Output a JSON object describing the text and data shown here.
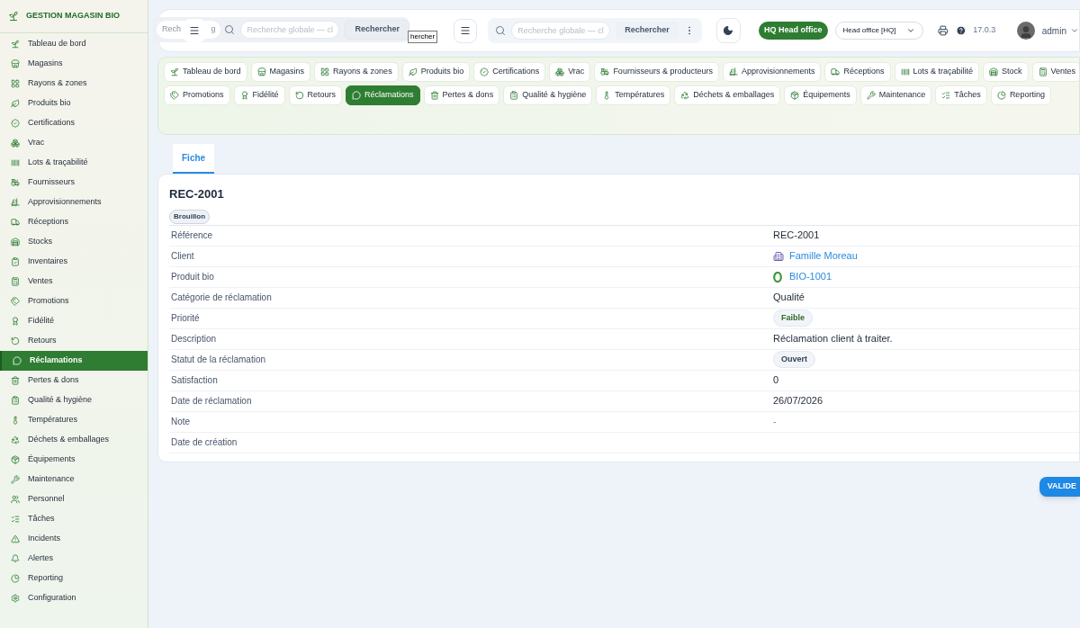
{
  "sidebar": {
    "brand": "GESTION MAGASIN BIO",
    "items": [
      {
        "label": "Tableau de bord",
        "selected": false
      },
      {
        "label": "Magasins",
        "selected": false
      },
      {
        "label": "Rayons & zones",
        "selected": false
      },
      {
        "label": "Produits bio",
        "selected": false
      },
      {
        "label": "Certifications",
        "selected": false
      },
      {
        "label": "Vrac",
        "selected": false
      },
      {
        "label": "Lots & traçabilité",
        "selected": false
      },
      {
        "label": "Fournisseurs",
        "selected": false
      },
      {
        "label": "Approvisionnements",
        "selected": false
      },
      {
        "label": "Réceptions",
        "selected": false
      },
      {
        "label": "Stocks",
        "selected": false
      },
      {
        "label": "Inventaires",
        "selected": false
      },
      {
        "label": "Ventes",
        "selected": false
      },
      {
        "label": "Promotions",
        "selected": false
      },
      {
        "label": "Fidélité",
        "selected": false
      },
      {
        "label": "Retours",
        "selected": false
      },
      {
        "label": "Réclamations",
        "selected": true
      },
      {
        "label": "Pertes & dons",
        "selected": false
      },
      {
        "label": "Qualité & hygiène",
        "selected": false
      },
      {
        "label": "Températures",
        "selected": false
      },
      {
        "label": "Déchets & emballages",
        "selected": false
      },
      {
        "label": "Équipements",
        "selected": false
      },
      {
        "label": "Maintenance",
        "selected": false
      },
      {
        "label": "Personnel",
        "selected": false
      },
      {
        "label": "Tâches",
        "selected": false
      },
      {
        "label": "Incidents",
        "selected": false
      },
      {
        "label": "Alertes",
        "selected": false
      },
      {
        "label": "Reporting",
        "selected": false
      },
      {
        "label": "Configuration",
        "selected": false
      }
    ]
  },
  "ghost_bar": {
    "placeholder_start": "Rech",
    "placeholder_end": "g",
    "search_placeholder": "Recherche globale — cl",
    "search_button": "Rechercher",
    "button_fragment": "hercher"
  },
  "header": {
    "search_placeholder": "Recherche globale — cl",
    "search_button": "Rechercher",
    "office_badge": "HQ Head office",
    "office_select": "Head office [HQ]",
    "version": "17.0.3",
    "user": "admin"
  },
  "module_nav": {
    "items": [
      {
        "label": "Tableau de bord",
        "selected": false
      },
      {
        "label": "Magasins",
        "selected": false
      },
      {
        "label": "Rayons & zones",
        "selected": false
      },
      {
        "label": "Produits bio",
        "selected": false
      },
      {
        "label": "Certifications",
        "selected": false
      },
      {
        "label": "Vrac",
        "selected": false
      },
      {
        "label": "Fournisseurs & producteurs",
        "selected": false
      },
      {
        "label": "Approvisionnements",
        "selected": false
      },
      {
        "label": "Réceptions",
        "selected": false
      },
      {
        "label": "Lots & traçabilité",
        "selected": false
      },
      {
        "label": "Stock",
        "selected": false
      },
      {
        "label": "Ventes",
        "selected": false
      },
      {
        "label": "Promotions",
        "selected": false
      },
      {
        "label": "Fidélité",
        "selected": false
      },
      {
        "label": "Retours",
        "selected": false
      },
      {
        "label": "Réclamations",
        "selected": true
      },
      {
        "label": "Pertes & dons",
        "selected": false
      },
      {
        "label": "Qualité & hygiène",
        "selected": false
      },
      {
        "label": "Températures",
        "selected": false
      },
      {
        "label": "Déchets & emballages",
        "selected": false
      },
      {
        "label": "Équipements",
        "selected": false
      },
      {
        "label": "Maintenance",
        "selected": false
      },
      {
        "label": "Tâches",
        "selected": false
      },
      {
        "label": "Reporting",
        "selected": false
      }
    ]
  },
  "tabs": [
    {
      "label": "Fiche",
      "selected": true
    }
  ],
  "record": {
    "title": "REC-2001",
    "status": "Brouillon",
    "fields": [
      {
        "label": "Référence",
        "kind": "text",
        "value": "REC-2001"
      },
      {
        "label": "Client",
        "kind": "client-link",
        "value": "Famille Moreau"
      },
      {
        "label": "Produit bio",
        "kind": "product-link",
        "value": "BIO-1001"
      },
      {
        "label": "Catégorie de réclamation",
        "kind": "text",
        "value": "Qualité"
      },
      {
        "label": "Priorité",
        "kind": "badge",
        "value": "Faible",
        "color": "#2e6b2a"
      },
      {
        "label": "Description",
        "kind": "text",
        "value": "Réclamation client à traiter."
      },
      {
        "label": "Statut de la réclamation",
        "kind": "badge",
        "value": "Ouvert",
        "color": "#334155"
      },
      {
        "label": "Satisfaction",
        "kind": "text",
        "value": "0"
      },
      {
        "label": "Date de réclamation",
        "kind": "text",
        "value": "26/07/2026"
      },
      {
        "label": "Note",
        "kind": "empty",
        "value": "-"
      },
      {
        "label": "Date de création",
        "kind": "empty"
      }
    ]
  },
  "action_button": "VALIDE"
}
